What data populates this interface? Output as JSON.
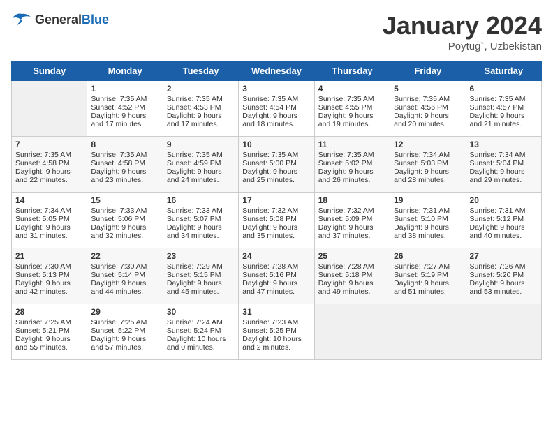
{
  "header": {
    "logo": {
      "general": "General",
      "blue": "Blue"
    },
    "title": "January 2024",
    "location": "Poytug`, Uzbekistan"
  },
  "weekdays": [
    "Sunday",
    "Monday",
    "Tuesday",
    "Wednesday",
    "Thursday",
    "Friday",
    "Saturday"
  ],
  "weeks": [
    [
      {
        "day": "",
        "empty": true
      },
      {
        "day": "1",
        "sunrise": "7:35 AM",
        "sunset": "4:52 PM",
        "daylight": "9 hours and 17 minutes."
      },
      {
        "day": "2",
        "sunrise": "7:35 AM",
        "sunset": "4:53 PM",
        "daylight": "9 hours and 17 minutes."
      },
      {
        "day": "3",
        "sunrise": "7:35 AM",
        "sunset": "4:54 PM",
        "daylight": "9 hours and 18 minutes."
      },
      {
        "day": "4",
        "sunrise": "7:35 AM",
        "sunset": "4:55 PM",
        "daylight": "9 hours and 19 minutes."
      },
      {
        "day": "5",
        "sunrise": "7:35 AM",
        "sunset": "4:56 PM",
        "daylight": "9 hours and 20 minutes."
      },
      {
        "day": "6",
        "sunrise": "7:35 AM",
        "sunset": "4:57 PM",
        "daylight": "9 hours and 21 minutes."
      }
    ],
    [
      {
        "day": "7",
        "sunrise": "7:35 AM",
        "sunset": "4:58 PM",
        "daylight": "9 hours and 22 minutes."
      },
      {
        "day": "8",
        "sunrise": "7:35 AM",
        "sunset": "4:58 PM",
        "daylight": "9 hours and 23 minutes."
      },
      {
        "day": "9",
        "sunrise": "7:35 AM",
        "sunset": "4:59 PM",
        "daylight": "9 hours and 24 minutes."
      },
      {
        "day": "10",
        "sunrise": "7:35 AM",
        "sunset": "5:00 PM",
        "daylight": "9 hours and 25 minutes."
      },
      {
        "day": "11",
        "sunrise": "7:35 AM",
        "sunset": "5:02 PM",
        "daylight": "9 hours and 26 minutes."
      },
      {
        "day": "12",
        "sunrise": "7:34 AM",
        "sunset": "5:03 PM",
        "daylight": "9 hours and 28 minutes."
      },
      {
        "day": "13",
        "sunrise": "7:34 AM",
        "sunset": "5:04 PM",
        "daylight": "9 hours and 29 minutes."
      }
    ],
    [
      {
        "day": "14",
        "sunrise": "7:34 AM",
        "sunset": "5:05 PM",
        "daylight": "9 hours and 31 minutes."
      },
      {
        "day": "15",
        "sunrise": "7:33 AM",
        "sunset": "5:06 PM",
        "daylight": "9 hours and 32 minutes."
      },
      {
        "day": "16",
        "sunrise": "7:33 AM",
        "sunset": "5:07 PM",
        "daylight": "9 hours and 34 minutes."
      },
      {
        "day": "17",
        "sunrise": "7:32 AM",
        "sunset": "5:08 PM",
        "daylight": "9 hours and 35 minutes."
      },
      {
        "day": "18",
        "sunrise": "7:32 AM",
        "sunset": "5:09 PM",
        "daylight": "9 hours and 37 minutes."
      },
      {
        "day": "19",
        "sunrise": "7:31 AM",
        "sunset": "5:10 PM",
        "daylight": "9 hours and 38 minutes."
      },
      {
        "day": "20",
        "sunrise": "7:31 AM",
        "sunset": "5:12 PM",
        "daylight": "9 hours and 40 minutes."
      }
    ],
    [
      {
        "day": "21",
        "sunrise": "7:30 AM",
        "sunset": "5:13 PM",
        "daylight": "9 hours and 42 minutes."
      },
      {
        "day": "22",
        "sunrise": "7:30 AM",
        "sunset": "5:14 PM",
        "daylight": "9 hours and 44 minutes."
      },
      {
        "day": "23",
        "sunrise": "7:29 AM",
        "sunset": "5:15 PM",
        "daylight": "9 hours and 45 minutes."
      },
      {
        "day": "24",
        "sunrise": "7:28 AM",
        "sunset": "5:16 PM",
        "daylight": "9 hours and 47 minutes."
      },
      {
        "day": "25",
        "sunrise": "7:28 AM",
        "sunset": "5:18 PM",
        "daylight": "9 hours and 49 minutes."
      },
      {
        "day": "26",
        "sunrise": "7:27 AM",
        "sunset": "5:19 PM",
        "daylight": "9 hours and 51 minutes."
      },
      {
        "day": "27",
        "sunrise": "7:26 AM",
        "sunset": "5:20 PM",
        "daylight": "9 hours and 53 minutes."
      }
    ],
    [
      {
        "day": "28",
        "sunrise": "7:25 AM",
        "sunset": "5:21 PM",
        "daylight": "9 hours and 55 minutes."
      },
      {
        "day": "29",
        "sunrise": "7:25 AM",
        "sunset": "5:22 PM",
        "daylight": "9 hours and 57 minutes."
      },
      {
        "day": "30",
        "sunrise": "7:24 AM",
        "sunset": "5:24 PM",
        "daylight": "10 hours and 0 minutes."
      },
      {
        "day": "31",
        "sunrise": "7:23 AM",
        "sunset": "5:25 PM",
        "daylight": "10 hours and 2 minutes."
      },
      {
        "day": "",
        "empty": true
      },
      {
        "day": "",
        "empty": true
      },
      {
        "day": "",
        "empty": true
      }
    ]
  ]
}
